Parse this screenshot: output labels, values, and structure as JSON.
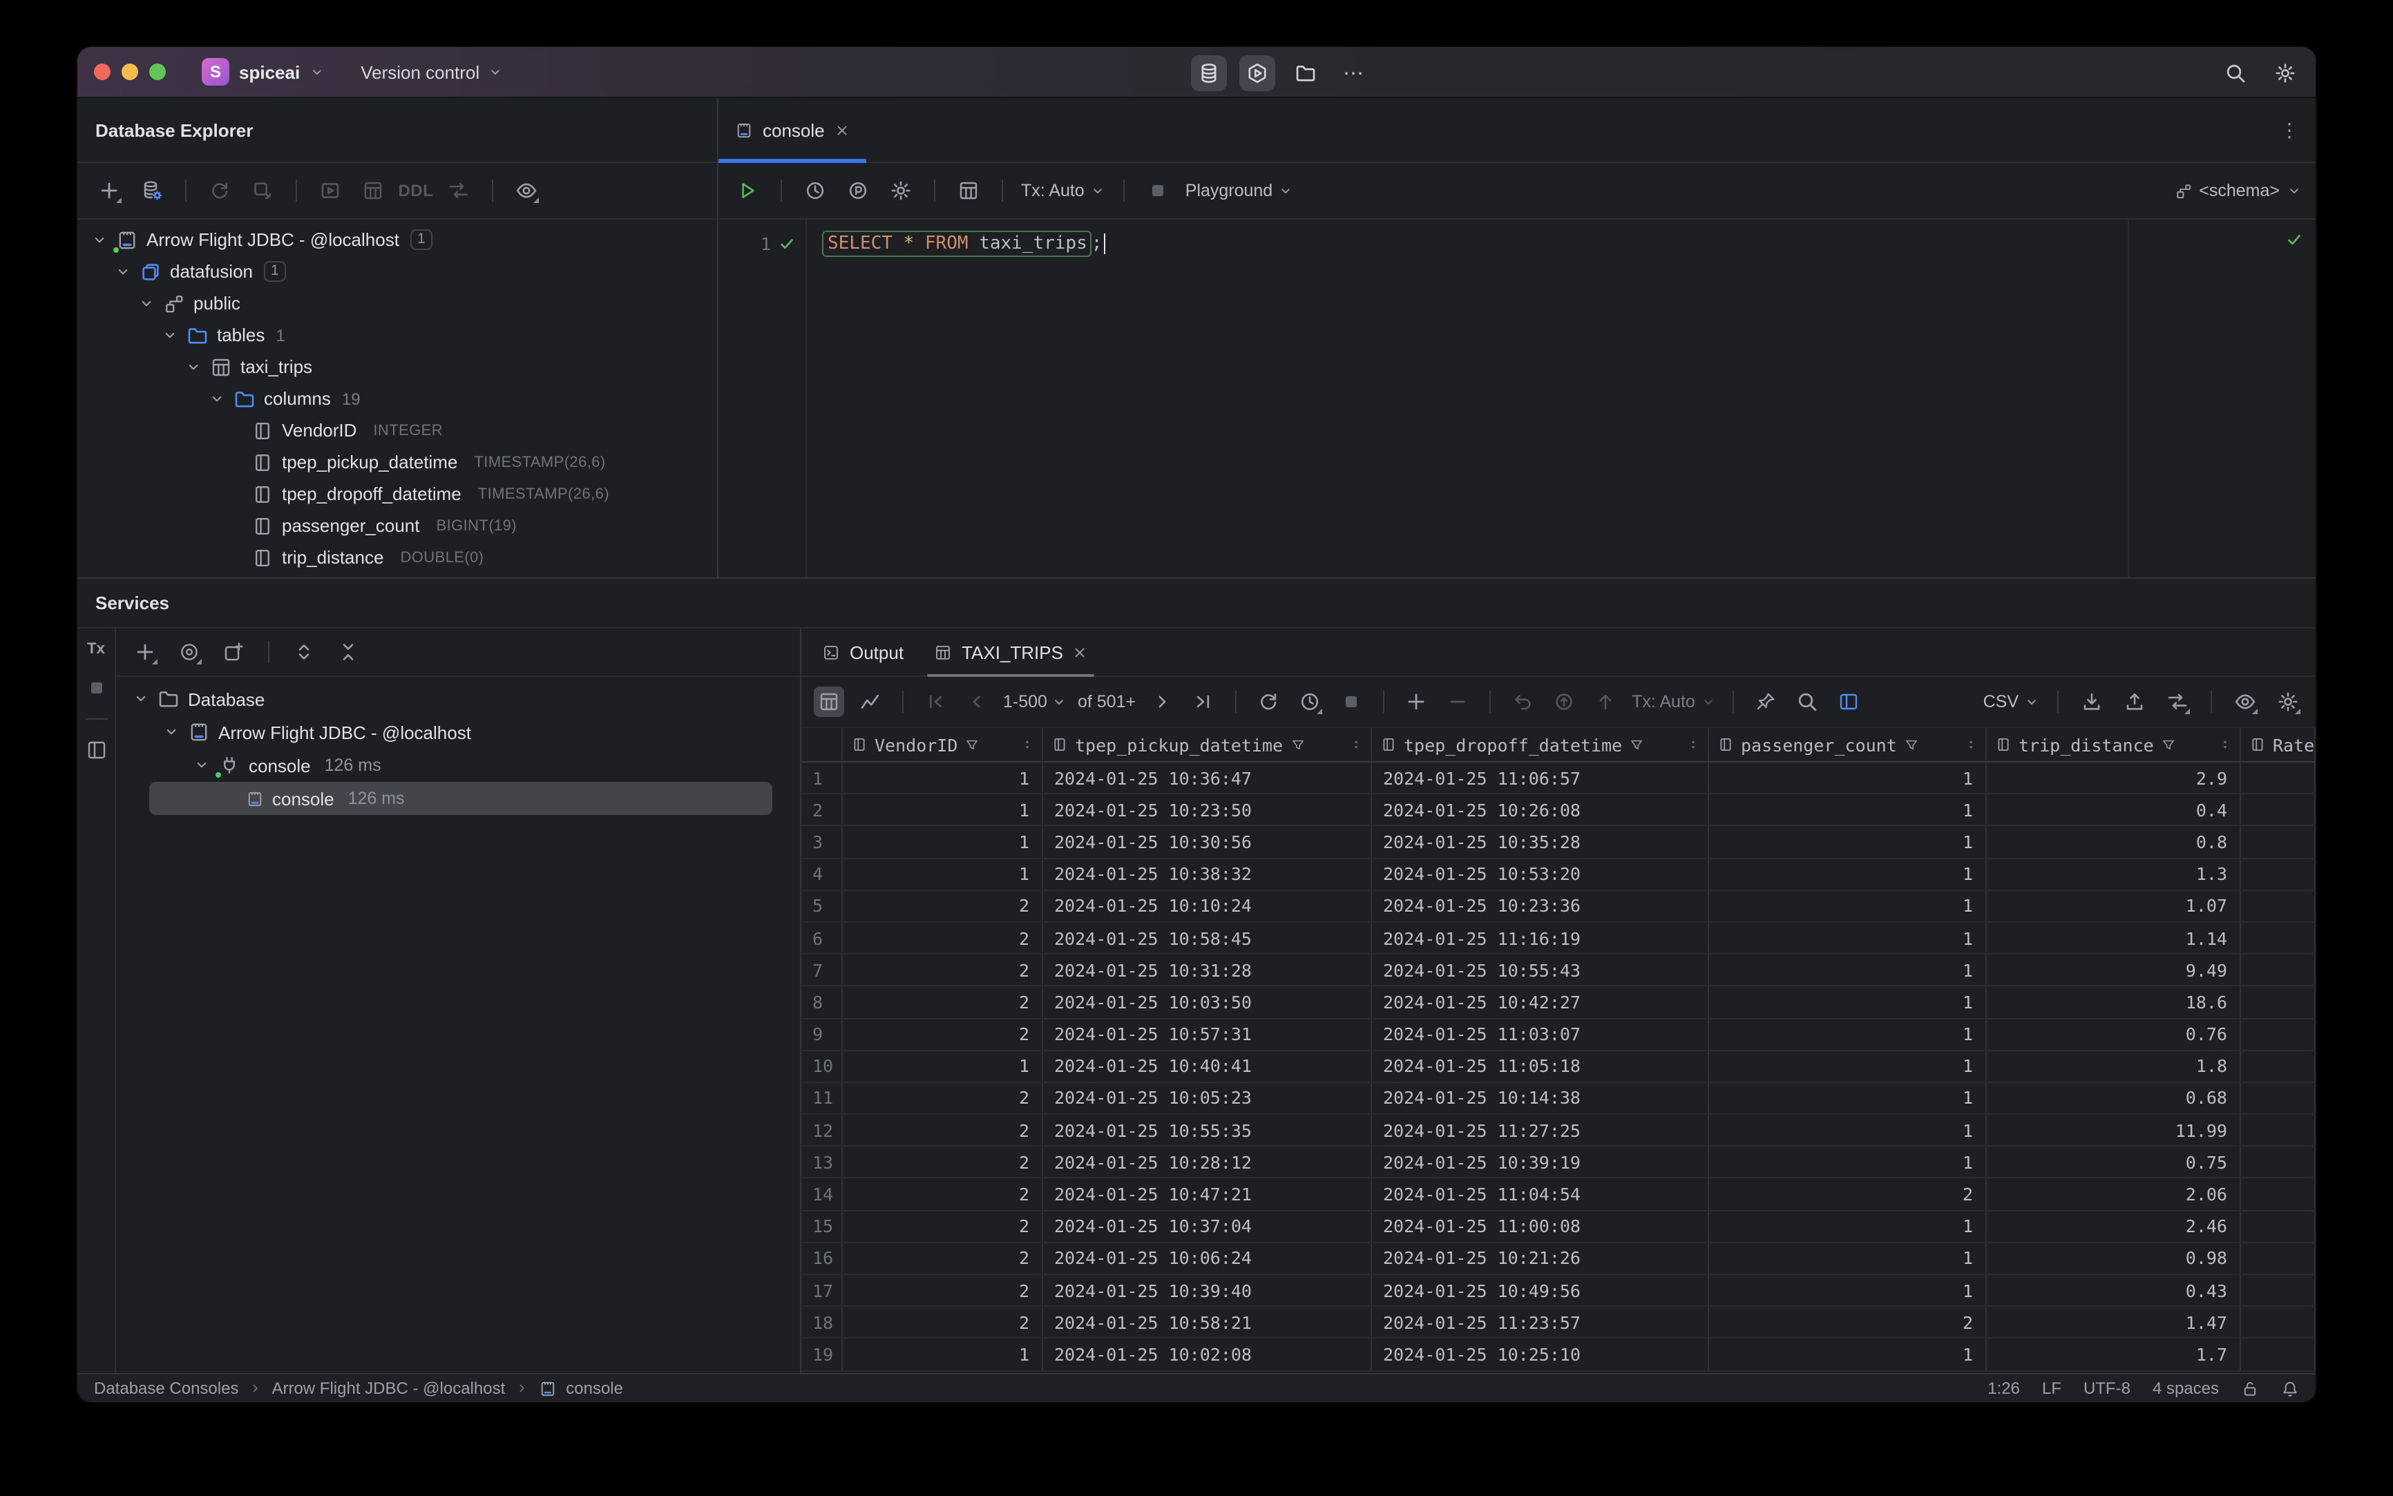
{
  "icons": {
    "more_horizontal": "⋯",
    "more_vertical": "⋮"
  },
  "colors": {
    "accent_blue": "#3574f0",
    "icon_blue": "#548af7",
    "green_run": "#57b05c",
    "keyword_orange": "#cf8e6d",
    "star_gold": "#d5b778",
    "selection_gray": "#43454a"
  },
  "titlebar": {
    "project": "spiceai",
    "menu": "Version control"
  },
  "database_explorer": {
    "title": "Database Explorer",
    "ddl_label": "DDL",
    "tree": [
      {
        "label": "Arrow Flight JDBC - @localhost",
        "badge": "1"
      },
      {
        "label": "datafusion",
        "badge": "1"
      },
      {
        "label": "public"
      },
      {
        "label": "tables",
        "count": "1"
      },
      {
        "label": "taxi_trips"
      },
      {
        "label": "columns",
        "count": "19"
      },
      {
        "label": "VendorID",
        "type": "INTEGER"
      },
      {
        "label": "tpep_pickup_datetime",
        "type": "TIMESTAMP(26,6)"
      },
      {
        "label": "tpep_dropoff_datetime",
        "type": "TIMESTAMP(26,6)"
      },
      {
        "label": "passenger_count",
        "type": "BIGINT(19)"
      },
      {
        "label": "trip_distance",
        "type": "DOUBLE(0)"
      }
    ]
  },
  "editor": {
    "tab": "console",
    "toolbar": {
      "tx": "Tx: Auto",
      "playground": "Playground",
      "schema": "<schema>"
    },
    "line_number": "1",
    "sql": {
      "kw1": "SELECT ",
      "star": "* ",
      "kw2": "FROM ",
      "ident": "taxi_trips",
      "semi": ";"
    }
  },
  "services": {
    "title": "Services",
    "tx_label": "Tx",
    "tree": [
      {
        "label": "Database"
      },
      {
        "label": "Arrow Flight JDBC - @localhost"
      },
      {
        "label": "console",
        "time": "126 ms"
      },
      {
        "label": "console",
        "time": "126 ms"
      }
    ]
  },
  "results": {
    "tabs": {
      "output": "Output",
      "table": "TAXI_TRIPS"
    },
    "toolbar": {
      "page_range": "1-500",
      "page_total": "of 501+",
      "tx": "Tx: Auto",
      "format": "CSV"
    },
    "grid": {
      "columns": [
        {
          "label": "VendorID",
          "align": "right"
        },
        {
          "label": "tpep_pickup_datetime",
          "align": "left"
        },
        {
          "label": "tpep_dropoff_datetime",
          "align": "left"
        },
        {
          "label": "passenger_count",
          "align": "right"
        },
        {
          "label": "trip_distance",
          "align": "right"
        },
        {
          "label": "Rate",
          "align": "left"
        }
      ],
      "rows": [
        [
          "1",
          "1",
          "2024-01-25 10:36:47",
          "2024-01-25 11:06:57",
          "1",
          "2.9",
          ""
        ],
        [
          "2",
          "1",
          "2024-01-25 10:23:50",
          "2024-01-25 10:26:08",
          "1",
          "0.4",
          ""
        ],
        [
          "3",
          "1",
          "2024-01-25 10:30:56",
          "2024-01-25 10:35:28",
          "1",
          "0.8",
          ""
        ],
        [
          "4",
          "1",
          "2024-01-25 10:38:32",
          "2024-01-25 10:53:20",
          "1",
          "1.3",
          ""
        ],
        [
          "5",
          "2",
          "2024-01-25 10:10:24",
          "2024-01-25 10:23:36",
          "1",
          "1.07",
          ""
        ],
        [
          "6",
          "2",
          "2024-01-25 10:58:45",
          "2024-01-25 11:16:19",
          "1",
          "1.14",
          ""
        ],
        [
          "7",
          "2",
          "2024-01-25 10:31:28",
          "2024-01-25 10:55:43",
          "1",
          "9.49",
          ""
        ],
        [
          "8",
          "2",
          "2024-01-25 10:03:50",
          "2024-01-25 10:42:27",
          "1",
          "18.6",
          ""
        ],
        [
          "9",
          "2",
          "2024-01-25 10:57:31",
          "2024-01-25 11:03:07",
          "1",
          "0.76",
          ""
        ],
        [
          "10",
          "1",
          "2024-01-25 10:40:41",
          "2024-01-25 11:05:18",
          "1",
          "1.8",
          ""
        ],
        [
          "11",
          "2",
          "2024-01-25 10:05:23",
          "2024-01-25 10:14:38",
          "1",
          "0.68",
          ""
        ],
        [
          "12",
          "2",
          "2024-01-25 10:55:35",
          "2024-01-25 11:27:25",
          "1",
          "11.99",
          ""
        ],
        [
          "13",
          "2",
          "2024-01-25 10:28:12",
          "2024-01-25 10:39:19",
          "1",
          "0.75",
          ""
        ],
        [
          "14",
          "2",
          "2024-01-25 10:47:21",
          "2024-01-25 11:04:54",
          "2",
          "2.06",
          ""
        ],
        [
          "15",
          "2",
          "2024-01-25 10:37:04",
          "2024-01-25 11:00:08",
          "1",
          "2.46",
          ""
        ],
        [
          "16",
          "2",
          "2024-01-25 10:06:24",
          "2024-01-25 10:21:26",
          "1",
          "0.98",
          ""
        ],
        [
          "17",
          "2",
          "2024-01-25 10:39:40",
          "2024-01-25 10:49:56",
          "1",
          "0.43",
          ""
        ],
        [
          "18",
          "2",
          "2024-01-25 10:58:21",
          "2024-01-25 11:23:57",
          "2",
          "1.47",
          ""
        ],
        [
          "19",
          "1",
          "2024-01-25 10:02:08",
          "2024-01-25 10:25:10",
          "1",
          "1.7",
          ""
        ]
      ]
    }
  },
  "statusbar": {
    "breadcrumb": [
      "Database Consoles",
      "Arrow Flight JDBC - @localhost",
      "console"
    ],
    "caret": "1:26",
    "line_ending": "LF",
    "encoding": "UTF-8",
    "indent": "4 spaces"
  }
}
